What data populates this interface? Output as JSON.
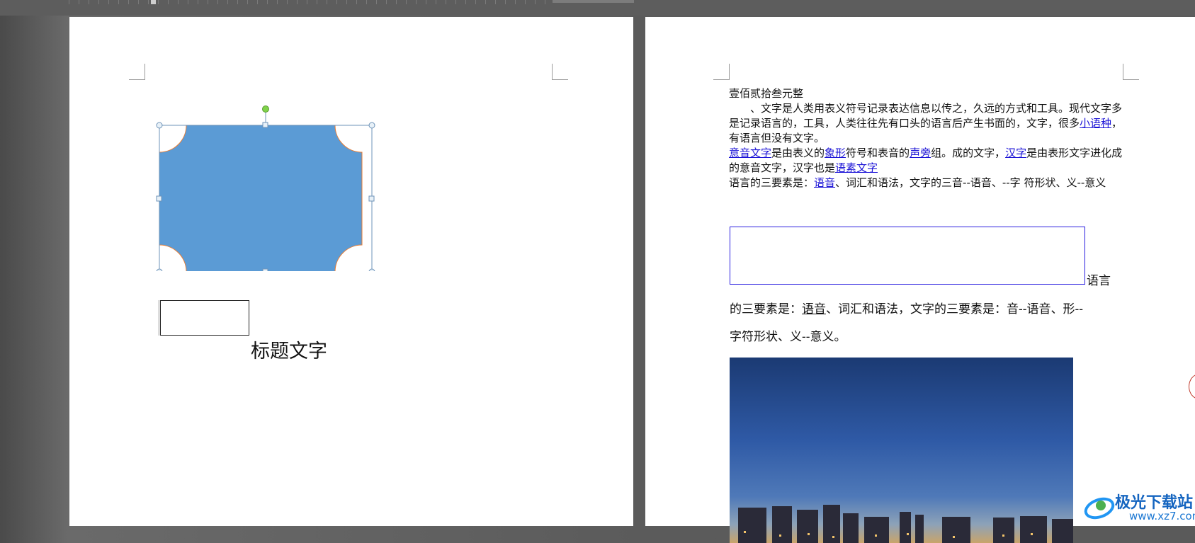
{
  "page1": {
    "title_text": "标题文字"
  },
  "page2": {
    "line1": "壹佰贰拾叁元整",
    "para1": "、文字是人类用表义符号记录表达信息以传之，久远的方式和工具。现代文字多是记录语言的，工具，人类往往先有口头的语言后产生书面的，文字，很多",
    "para1_link": "小语种",
    "para1_end": "，有语言但没有文字。",
    "para2_link1": "意音文字",
    "para2_t1": "是由表义的",
    "para2_link2": "象形",
    "para2_t2": "符号和表音的",
    "para2_link3": "声旁",
    "para2_t3": "组。成的文字，",
    "para2_link4": "汉字",
    "para2_t4": "是由表形文字进化成的意音文字，汉字也是",
    "para2_link5": "语素文字",
    "para3_t1": "语言的三要素是：",
    "para3_link": "语音",
    "para3_t2": "、词汇和语法，文字的三音--语音、--字 符形状、义--意义",
    "after_box": "语言",
    "serif_line1_a": "的三要素是：",
    "serif_line1_u": "语音",
    "serif_line1_b": "、词汇和语法，文字的三要素是：音--语音、形--",
    "serif_line2": "字符形状、义--意义。"
  },
  "watermark": {
    "name": "极光下载站",
    "url": "www.xz7.com"
  },
  "colors": {
    "shape_fill": "#5b9bd5",
    "shape_outline": "#ed7d31",
    "selection_handle": "#7fd34a",
    "link": "#1a12d6"
  }
}
